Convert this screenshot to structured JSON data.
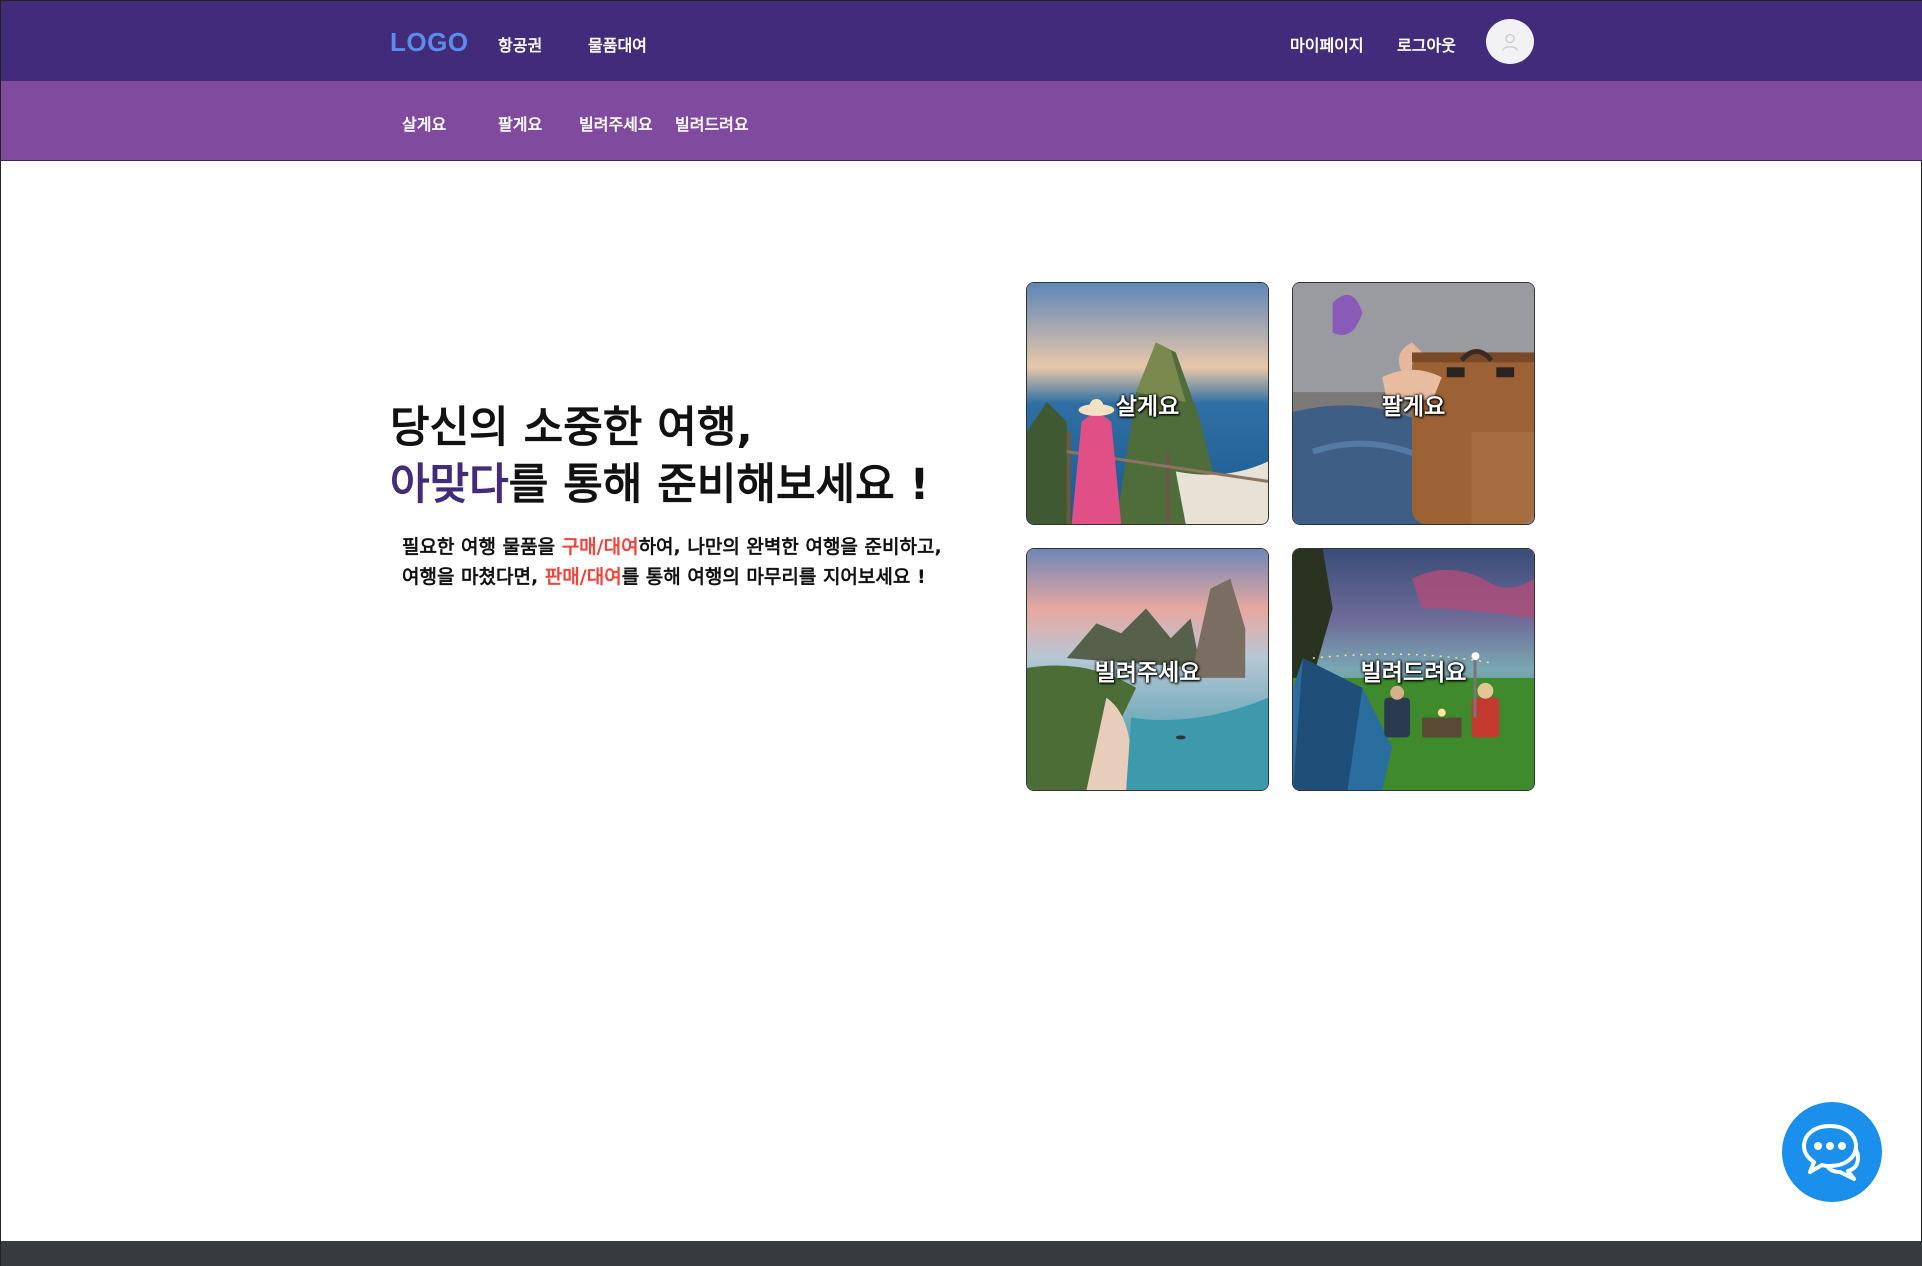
{
  "header": {
    "logo": "LOGO",
    "nav": [
      {
        "label": "항공권"
      },
      {
        "label": "물품대여"
      }
    ],
    "mypage": "마이페이지",
    "logout": "로그아웃"
  },
  "subnav": {
    "items": [
      {
        "label": "살게요"
      },
      {
        "label": "팔게요"
      },
      {
        "label": "빌려주세요"
      },
      {
        "label": "빌려드려요"
      }
    ]
  },
  "hero": {
    "title_line1": "당신의 소중한 여행,",
    "title_brand": "아맞다",
    "title_line2_rest": "를 통해 준비해보세요 !",
    "desc1_a": "필요한 여행 물품을 ",
    "desc1_hl": "구매/대여",
    "desc1_b": "하여, 나만의 완벽한 여행을 준비하고,",
    "desc2_a": "여행을 마쳤다면, ",
    "desc2_hl": "판매/대여",
    "desc2_b": "를 통해 여행의 마무리를 지어보세요 !"
  },
  "cards": [
    {
      "label": "살게요"
    },
    {
      "label": "팔게요"
    },
    {
      "label": "빌려주세요"
    },
    {
      "label": "빌려드려요"
    }
  ],
  "colors": {
    "header_bg": "#422b7a",
    "subnav_bg": "#804a9e",
    "logo": "#5b8de8",
    "brand_text": "#432b78",
    "highlight": "#f0453c",
    "chat_button": "#1a90ec",
    "footer": "#363b3d"
  },
  "icons": {
    "avatar": "user-icon",
    "chat": "chat-bubble-icon"
  }
}
